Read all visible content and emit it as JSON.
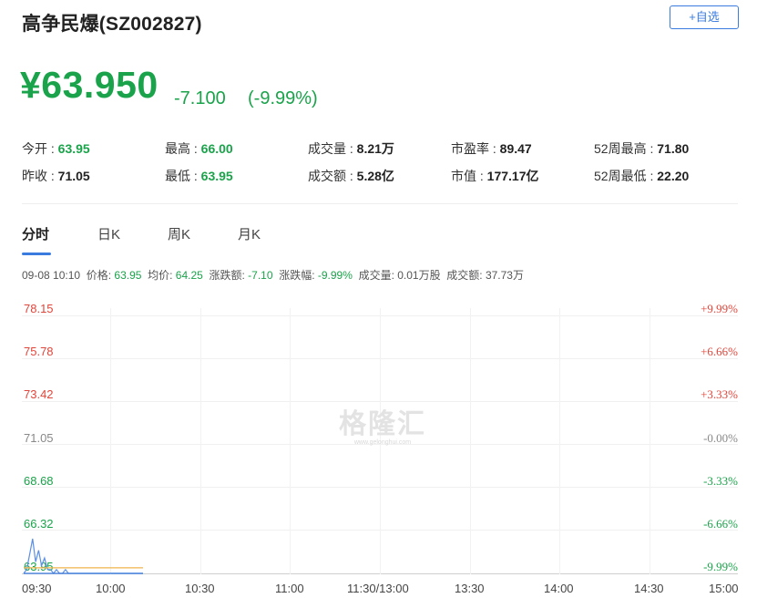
{
  "header": {
    "title": "高争民爆(SZ002827)",
    "add_button": "+自选"
  },
  "quote": {
    "price": "¥63.950",
    "change": "-7.100",
    "change_pct": "(-9.99%)"
  },
  "stats": {
    "open": {
      "label": "今开 : ",
      "value": "63.95"
    },
    "prev_close": {
      "label": "昨收 : ",
      "value": "71.05"
    },
    "high": {
      "label": "最高 : ",
      "value": "66.00"
    },
    "low": {
      "label": "最低 : ",
      "value": "63.95"
    },
    "volume": {
      "label": "成交量 : ",
      "value": "8.21万"
    },
    "turnover": {
      "label": "成交额 : ",
      "value": "5.28亿"
    },
    "pe": {
      "label": "市盈率 : ",
      "value": "89.47"
    },
    "market_cap": {
      "label": "市值 : ",
      "value": "177.17亿"
    },
    "high52": {
      "label": "52周最高 : ",
      "value": "71.80"
    },
    "low52": {
      "label": "52周最低 : ",
      "value": "22.20"
    }
  },
  "tabs": [
    "分时",
    "日K",
    "周K",
    "月K"
  ],
  "infobar": {
    "datetime": "09-08 10:10",
    "price_label": "价格: ",
    "price": "63.95",
    "avg_label": "均价: ",
    "avg": "64.25",
    "chg_label": "涨跌额: ",
    "chg": "-7.10",
    "pct_label": "涨跌幅: ",
    "pct": "-9.99%",
    "vol_label": "成交量: ",
    "vol": "0.01万股",
    "amt_label": "成交额: ",
    "amt": "37.73万"
  },
  "watermark": {
    "name": "格隆汇",
    "url": "www.gelonghui.com"
  },
  "colors": {
    "up": "#e0453a",
    "down": "#1aa34a",
    "accent": "#3a7be0",
    "avg_line": "#f0b44c"
  },
  "chart_data": {
    "type": "line",
    "y_labels": [
      "78.15",
      "75.78",
      "73.42",
      "71.05",
      "68.68",
      "66.32",
      "63.95"
    ],
    "pct_labels": [
      "+9.99%",
      "+6.66%",
      "+3.33%",
      "-0.00%",
      "-3.33%",
      "-6.66%",
      "-9.99%"
    ],
    "x_labels": [
      "09:30",
      "10:00",
      "10:30",
      "11:00",
      "11:30/13:00",
      "13:30",
      "14:00",
      "14:30",
      "15:00"
    ],
    "ylim": [
      63.95,
      78.15
    ],
    "series": [
      {
        "values": [
          63.95,
          63.95,
          63.95,
          63.95,
          63.95,
          63.95,
          63.95,
          63.95,
          63.95,
          63.95,
          63.95,
          63.95,
          63.95,
          63.95,
          63.95,
          63.95,
          63.95,
          63.95,
          63.95,
          63.95,
          63.95,
          63.95,
          63.95,
          63.95,
          63.95,
          63.95,
          63.95,
          63.95,
          63.95,
          63.95,
          63.95,
          63.95,
          63.95,
          63.95,
          63.95,
          63.95,
          63.95,
          63.95,
          63.95,
          63.95,
          63.95
        ]
      },
      {
        "values": [
          64.25,
          64.25,
          64.25,
          64.25,
          64.25,
          64.25,
          64.25,
          64.25,
          64.25,
          64.25,
          64.25,
          64.25,
          64.25,
          64.25,
          64.25,
          64.25,
          64.25,
          64.25,
          64.25,
          64.25,
          64.25,
          64.25,
          64.25,
          64.25,
          64.25,
          64.25,
          64.25,
          64.25,
          64.25,
          64.25,
          64.25,
          64.25,
          64.25,
          64.25,
          64.25,
          64.25,
          64.25,
          64.25,
          64.25,
          64.25,
          64.25
        ]
      }
    ],
    "volume": [
      0,
      1,
      5,
      9,
      3,
      6,
      2,
      4,
      1,
      1,
      0,
      1,
      0,
      0,
      1,
      0,
      0,
      0,
      0,
      0,
      0,
      0,
      0,
      0,
      0,
      0,
      0,
      0,
      0,
      0,
      0,
      0,
      0,
      0,
      0,
      0,
      0,
      0,
      0,
      0,
      0
    ],
    "grid": true
  }
}
